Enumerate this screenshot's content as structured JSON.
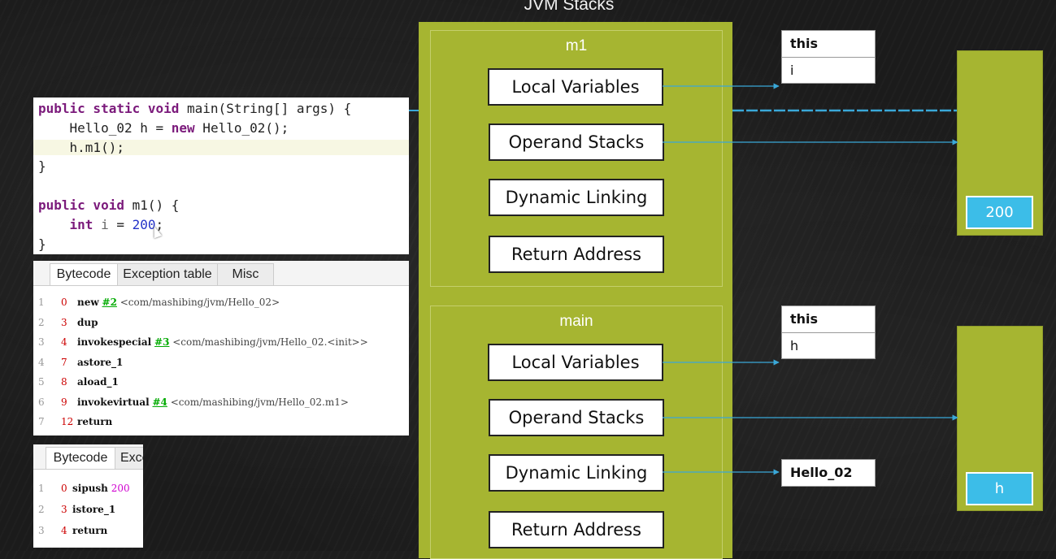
{
  "title": "JVM Stacks",
  "frames": [
    {
      "name": "m1",
      "slots": [
        "Local Variables",
        "Operand Stacks",
        "Dynamic Linking",
        "Return Address"
      ]
    },
    {
      "name": "main",
      "slots": [
        "Local Variables",
        "Operand Stacks",
        "Dynamic Linking",
        "Return Address"
      ]
    }
  ],
  "code": {
    "lines": [
      {
        "parts": [
          [
            "kw",
            "public static void"
          ],
          [
            "t",
            " main(String[] args) {"
          ]
        ]
      },
      {
        "parts": [
          [
            "t",
            "    Hello_02 h = "
          ],
          [
            "kw",
            "new"
          ],
          [
            "t",
            " Hello_02();"
          ]
        ]
      },
      {
        "parts": [
          [
            "t",
            "    h.m1();"
          ]
        ],
        "hl": true
      },
      {
        "parts": [
          [
            "t",
            "}"
          ]
        ]
      },
      {
        "parts": [
          [
            "t",
            ""
          ]
        ]
      },
      {
        "parts": [
          [
            "kw",
            "public void"
          ],
          [
            "t",
            " m1() {"
          ]
        ]
      },
      {
        "parts": [
          [
            "t",
            "    "
          ],
          [
            "kw",
            "int"
          ],
          [
            "var",
            " i"
          ],
          [
            "t",
            " = "
          ],
          [
            "num",
            "200"
          ],
          [
            "t",
            ";"
          ]
        ]
      },
      {
        "parts": [
          [
            "t",
            "}"
          ]
        ]
      }
    ]
  },
  "bytecode_main": {
    "tabs": [
      "Bytecode",
      "Exception table",
      "Misc"
    ],
    "rows": [
      {
        "n": "1",
        "off": "0",
        "op": "new",
        "ref": "#2",
        "comment": " <com/mashibing/jvm/Hello_02>"
      },
      {
        "n": "2",
        "off": "3",
        "op": "dup",
        "ref": "",
        "comment": ""
      },
      {
        "n": "3",
        "off": "4",
        "op": "invokespecial",
        "ref": "#3",
        "comment": " <com/mashibing/jvm/Hello_02.<init>>"
      },
      {
        "n": "4",
        "off": "7",
        "op": "astore_1",
        "ref": "",
        "comment": ""
      },
      {
        "n": "5",
        "off": "8",
        "op": "aload_1",
        "ref": "",
        "comment": ""
      },
      {
        "n": "6",
        "off": "9",
        "op": "invokevirtual",
        "ref": "#4",
        "comment": " <com/mashibing/jvm/Hello_02.m1>"
      },
      {
        "n": "7",
        "off": "12",
        "op": "return",
        "ref": "",
        "comment": ""
      }
    ]
  },
  "bytecode_m1": {
    "tabs": [
      "Bytecode",
      "Exce"
    ],
    "rows": [
      {
        "n": "1",
        "off": "0",
        "op": "sipush",
        "arg": "200"
      },
      {
        "n": "2",
        "off": "3",
        "op": "istore_1",
        "arg": ""
      },
      {
        "n": "3",
        "off": "4",
        "op": "return",
        "arg": ""
      }
    ]
  },
  "m1_locals": [
    "this",
    "i"
  ],
  "main_locals": [
    "this",
    "h"
  ],
  "dynamic_link_target": "Hello_02",
  "m1_operand_value": "200",
  "main_operand_value": "h",
  "colors": {
    "frame": "#a6b531",
    "heap_cell": "#3cbde8",
    "arrow": "#3aa8d8"
  }
}
